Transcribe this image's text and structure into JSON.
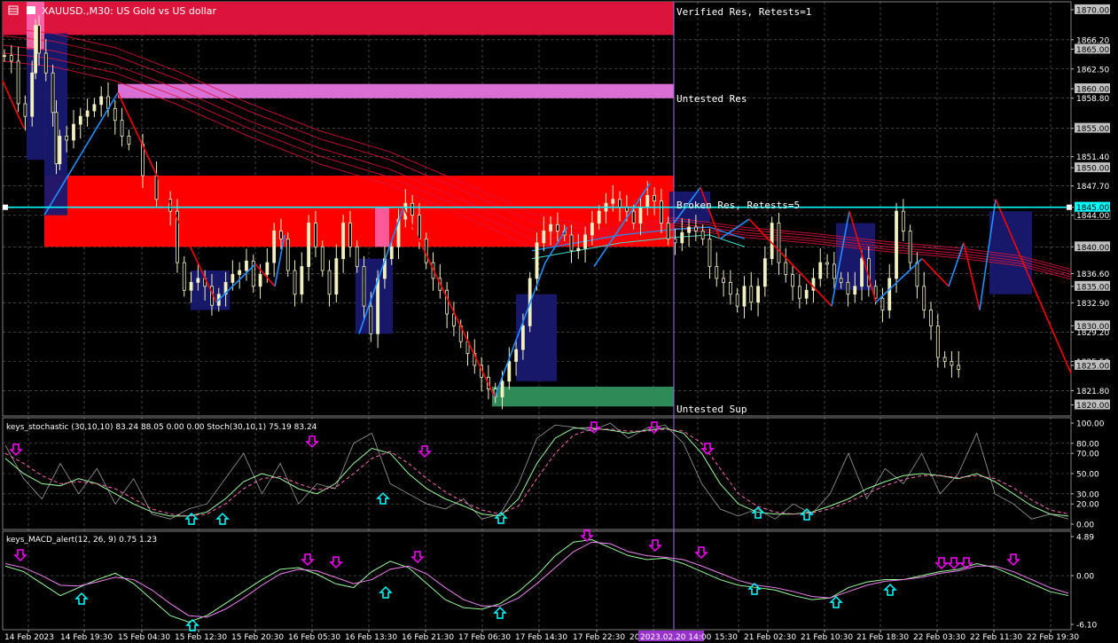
{
  "window": {
    "title": "XAUUSD.,M30:  US Gold vs US dollar"
  },
  "colors": {
    "background": "#000000",
    "grid": "#c0c0c0",
    "candle": "#f0f0c0",
    "resistance_strong": "#dc143c",
    "resistance_untested": "#da70d6",
    "resistance_broken": "#ff0000",
    "support_untested": "#2e8b57",
    "moving_average": "#dc143c",
    "moving_average_fast": "#1e90ff",
    "zigzag_up": "#1e90ff",
    "zigzag_down": "#ff0000",
    "level_line": "#00ffff",
    "block": "#191970",
    "stoch_main": "#98fb98",
    "stoch_signal": "#ff69b4",
    "stoch_raw": "#c0c0c0",
    "macd_main": "#98fb98",
    "macd_signal": "#ee82ee",
    "arrow_up": "#00ffff",
    "arrow_down": "#ff00ff",
    "price_tag": "#c0c0c0",
    "time_tag": "#9932cc"
  },
  "chart_data": [
    {
      "panel": "price",
      "type": "candlestick",
      "symbol": "XAUUSD.",
      "timeframe": "M30",
      "description": "US Gold vs US dollar",
      "ylim": [
        1818.6,
        1871.0
      ],
      "y_ticks": [
        "1870.00",
        "1866.20",
        "1865.00",
        "1862.50",
        "1860.00",
        "1858.80",
        "1855.00",
        "1851.40",
        "1850.00",
        "1847.70",
        "1845.00",
        "1844.00",
        "1840.00",
        "1836.60",
        "1835.00",
        "1832.90",
        "1830.00",
        "1829.20",
        "1825.50",
        "1825.00",
        "1821.80",
        "1820.00"
      ],
      "y_tick_boxed": [
        "1870.00",
        "1865.00",
        "1860.00",
        "1855.00",
        "1850.00",
        "1845.00",
        "1840.00",
        "1835.00",
        "1830.00",
        "1825.00",
        "1820.00"
      ],
      "grid": true,
      "x_ticks": [
        "14 Feb 2023",
        "14 Feb 19:30",
        "15 Feb 04:30",
        "15 Feb 12:30",
        "15 Feb 20:30",
        "16 Feb 05:30",
        "16 Feb 13:30",
        "16 Feb 21:30",
        "17 Feb 06:30",
        "17 Feb 14:30",
        "17 Feb 22:30",
        "20",
        "2023.02.20 14:00",
        "15:30",
        "21 Feb 02:30",
        "21 Feb 10:30",
        "21 Feb 18:30",
        "22 Feb 03:30",
        "22 Feb 11:30",
        "22 Feb 19:30"
      ],
      "crosshair_time": "2023.02.20 14:00",
      "crosshair_price": "1844.00",
      "level_line": 1845.0,
      "close_series_x": [
        0,
        2,
        4,
        6,
        8,
        9,
        10,
        12,
        14,
        15,
        16,
        18,
        20,
        22,
        24,
        26,
        28,
        30,
        32,
        34,
        36,
        40,
        44,
        48,
        50,
        52,
        54,
        56,
        58,
        60,
        62,
        64,
        66,
        68,
        70,
        72,
        74,
        76,
        78,
        80,
        82,
        84,
        86,
        88,
        90,
        92,
        94,
        96,
        98,
        100,
        102,
        104,
        106,
        108,
        110,
        112,
        114,
        116,
        118,
        120,
        122,
        124,
        126,
        128,
        130,
        132,
        134,
        136,
        138,
        140,
        142,
        144,
        146,
        148,
        150,
        152,
        154,
        156,
        158,
        160,
        162,
        164,
        166,
        168,
        170,
        172,
        174,
        176,
        178,
        180,
        182,
        184,
        186,
        188,
        190,
        192,
        194,
        196,
        198,
        200,
        202,
        204,
        206,
        208,
        210,
        212,
        214,
        216,
        218,
        220,
        222,
        224,
        226,
        228,
        230,
        232,
        234,
        236,
        238,
        240,
        242,
        244,
        246,
        248,
        250,
        252,
        254,
        256,
        258,
        260,
        262,
        264,
        266,
        268,
        270,
        272,
        274,
        276,
        278,
        280,
        282,
        284,
        286,
        288,
        290,
        292,
        294,
        296,
        298,
        300,
        302,
        304,
        306,
        308
      ],
      "close_series": [
        1864.2,
        1863.5,
        1858.1,
        1856.5,
        1862.0,
        1868.0,
        1864.5,
        1862.0,
        1857.0,
        1850.5,
        1854.0,
        1853.5,
        1855.5,
        1856.5,
        1857.2,
        1858.0,
        1859.0,
        1857.5,
        1856.0,
        1854.0,
        1853.0,
        1849.0,
        1846.0,
        1844.5,
        1838.0,
        1834.5,
        1835.5,
        1836.0,
        1835.0,
        1832.6,
        1834.0,
        1835.5,
        1836.5,
        1837.0,
        1838.2,
        1835.0,
        1836.5,
        1838.0,
        1842.0,
        1841.0,
        1837.0,
        1834.0,
        1837.5,
        1843.0,
        1840.0,
        1837.0,
        1834.0,
        1838.5,
        1843.0,
        1840.0,
        1837.5,
        1832.5,
        1829.0,
        1836.0,
        1838.5,
        1840.0,
        1843.5,
        1845.5,
        1844.0,
        1841.0,
        1838.0,
        1836.0,
        1834.5,
        1831.5,
        1830.0,
        1828.0,
        1826.5,
        1825.0,
        1823.5,
        1822.0,
        1821.0,
        1823.0,
        1825.5,
        1827.0,
        1830.0,
        1836.0,
        1840.5,
        1842.0,
        1842.8,
        1842.0,
        1841.5,
        1839.5,
        1839.8,
        1841.5,
        1843.0,
        1844.5,
        1845.5,
        1846.0,
        1845.0,
        1844.5,
        1843.0,
        1845.0,
        1846.5,
        1845.8,
        1843.0,
        1841.0,
        1840.5,
        1841.8,
        1842.5,
        1842.0,
        1841.0,
        1837.5,
        1836.0,
        1835.5,
        1834.0,
        1832.5,
        1835.0,
        1833.0,
        1835.0,
        1838.5,
        1843.0,
        1838.0,
        1836.5,
        1835.0,
        1833.5,
        1834.5,
        1836.0,
        1838.0,
        1837.8,
        1836.0,
        1835.5,
        1834.0,
        1835.0,
        1838.5,
        1835.0,
        1833.5,
        1832.0,
        1836.0,
        1844.5,
        1842.0,
        1838.0,
        1835.0,
        1832.0,
        1830.0,
        1826.0,
        1825.5,
        1825.0,
        1824.5
      ],
      "zones": [
        {
          "label": "Verified Res, Retests=1",
          "type": "resistance",
          "from": 1866.8,
          "to": 1871.0
        },
        {
          "label": "Untested Res",
          "type": "resistance",
          "from": 1858.8,
          "to": 1860.6
        },
        {
          "label": "Broken Res, Retests=5",
          "type": "resistance",
          "from": 1840.0,
          "to": 1849.0
        },
        {
          "label": "Untested Sup",
          "type": "support",
          "from": 1819.8,
          "to": 1822.3
        }
      ]
    },
    {
      "panel": "stochastic",
      "type": "line",
      "indicator": "keys_stochastic (30,10,10) 83.24 88.05 0.00 0.00 Stoch(30,10,1) 75.19 83.24",
      "ylim": [
        0,
        100
      ],
      "y_ticks": [
        "100.00",
        "80.00",
        "70.00",
        "50.00",
        "30.00",
        "20.00",
        "0.00"
      ],
      "series": [
        {
          "name": "main",
          "values": [
            65,
            50,
            40,
            38,
            45,
            40,
            30,
            20,
            12,
            8,
            8,
            12,
            25,
            42,
            50,
            45,
            35,
            30,
            40,
            60,
            75,
            70,
            50,
            35,
            25,
            18,
            10,
            8,
            25,
            60,
            85,
            95,
            95,
            93,
            90,
            93,
            95,
            90,
            70,
            40,
            20,
            12,
            10,
            10,
            12,
            18,
            25,
            35,
            42,
            48,
            50,
            48,
            45,
            50,
            42,
            30,
            18,
            10,
            8
          ]
        },
        {
          "name": "signal",
          "values": [
            70,
            60,
            48,
            40,
            42,
            40,
            35,
            25,
            15,
            10,
            8,
            10,
            20,
            35,
            45,
            47,
            40,
            34,
            36,
            50,
            65,
            72,
            60,
            45,
            32,
            22,
            14,
            10,
            18,
            45,
            70,
            88,
            94,
            94,
            92,
            92,
            94,
            92,
            80,
            55,
            30,
            18,
            12,
            10,
            11,
            15,
            22,
            30,
            38,
            44,
            48,
            48,
            46,
            48,
            45,
            36,
            24,
            14,
            10
          ]
        },
        {
          "name": "raw",
          "values": [
            78,
            45,
            25,
            60,
            30,
            55,
            20,
            45,
            10,
            5,
            15,
            20,
            45,
            70,
            30,
            60,
            20,
            40,
            35,
            80,
            90,
            40,
            30,
            20,
            15,
            25,
            5,
            10,
            40,
            85,
            98,
            96,
            92,
            100,
            85,
            95,
            98,
            80,
            40,
            15,
            8,
            15,
            5,
            20,
            10,
            30,
            70,
            25,
            55,
            40,
            70,
            30,
            50,
            90,
            30,
            20,
            5,
            10,
            5
          ]
        }
      ],
      "arrows_down_x": [
        2,
        33,
        44,
        64,
        72,
        78
      ],
      "arrows_up_x": [
        13,
        14,
        25,
        33,
        53,
        57,
        66
      ]
    },
    {
      "panel": "macd",
      "type": "line",
      "indicator": "keys_MACD_alert(12, 26, 9) 0.75 1.23",
      "ylim": [
        -6.1,
        4.89
      ],
      "y_ticks": [
        "4.89",
        "0.00",
        "-6.10"
      ],
      "series": [
        {
          "name": "main",
          "values": [
            1.2,
            0.5,
            -1.0,
            -2.5,
            -1.5,
            -0.5,
            0.3,
            -1.0,
            -3.0,
            -5.0,
            -5.8,
            -5.0,
            -3.5,
            -2.0,
            -0.5,
            0.8,
            1.0,
            0.2,
            -1.0,
            -1.5,
            0.5,
            1.8,
            1.0,
            -1.0,
            -3.0,
            -4.0,
            -4.2,
            -3.5,
            -2.0,
            0.0,
            2.5,
            4.2,
            4.5,
            3.5,
            2.5,
            2.0,
            2.2,
            1.5,
            0.5,
            -0.5,
            -1.2,
            -1.5,
            -1.8,
            -2.5,
            -3.0,
            -2.8,
            -1.5,
            -0.8,
            -0.5,
            -0.5,
            0.0,
            0.5,
            0.8,
            1.5,
            1.0,
            0.0,
            -1.0,
            -2.0,
            -2.5
          ]
        },
        {
          "name": "signal",
          "values": [
            1.5,
            1.0,
            0.0,
            -1.2,
            -1.3,
            -0.8,
            -0.2,
            -0.5,
            -1.8,
            -3.5,
            -5.0,
            -5.2,
            -4.2,
            -2.8,
            -1.2,
            0.2,
            0.8,
            0.6,
            -0.2,
            -1.0,
            -0.5,
            0.8,
            1.2,
            0.2,
            -1.5,
            -3.0,
            -3.8,
            -3.8,
            -2.8,
            -1.0,
            1.0,
            3.0,
            4.2,
            4.0,
            3.0,
            2.5,
            2.3,
            2.0,
            1.2,
            0.3,
            -0.6,
            -1.2,
            -1.5,
            -2.0,
            -2.6,
            -2.8,
            -2.0,
            -1.2,
            -0.7,
            -0.5,
            -0.2,
            0.3,
            0.6,
            1.2,
            1.2,
            0.5,
            -0.5,
            -1.5,
            -2.2
          ]
        }
      ],
      "arrows_down_x": [
        3,
        51,
        58,
        71,
        95,
        118,
        149,
        178,
        180,
        182,
        189
      ],
      "arrows_up_x": [
        17,
        42,
        87,
        111,
        171,
        195
      ]
    }
  ]
}
